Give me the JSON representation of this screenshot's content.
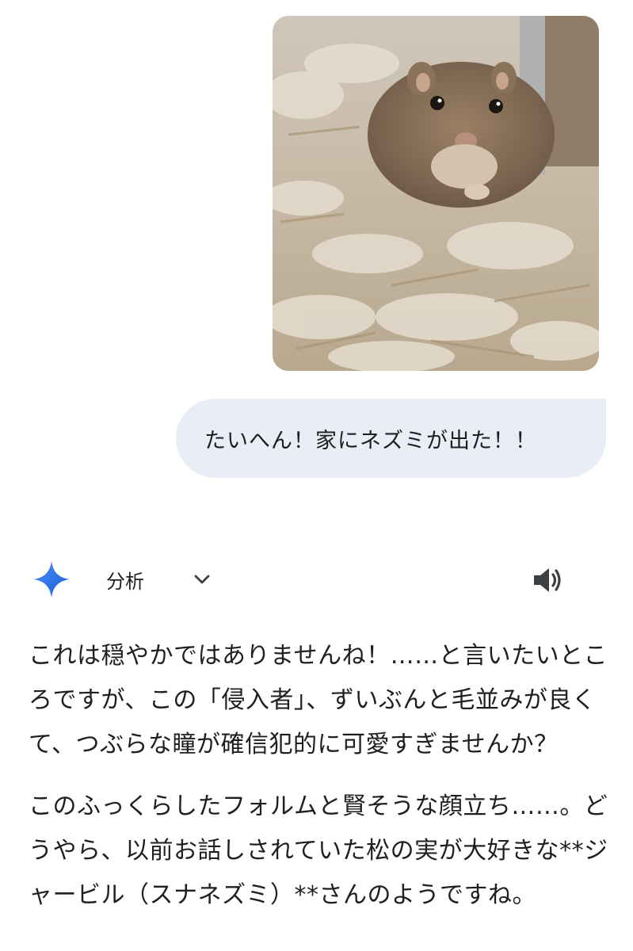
{
  "user_message": {
    "image_alt_icon": "gerbil-photo",
    "text": "たいへん！家にネズミが出た！！"
  },
  "response_header": {
    "assistant_icon": "gemini-sparkle-icon",
    "mode_label": "分析",
    "toggle_icon": "chevron-down-icon",
    "audio_icon": "speaker-icon"
  },
  "response": {
    "paragraphs": [
      "これは穏やかではありませんね！……と言いたいところですが、この「侵入者」、ずいぶんと毛並みが良くて、つぶらな瞳が確信犯的に可愛すぎませんか？",
      "このふっくらしたフォルムと賢そうな顔立ち……。どうやら、以前お話しされていた松の実が大好きな**ジャービル（スナネズミ）**さんのようですね。"
    ]
  },
  "colors": {
    "bubble_bg": "#e9eef6",
    "sparkle_gradient": [
      "#4285f4",
      "#1a73e8"
    ]
  }
}
